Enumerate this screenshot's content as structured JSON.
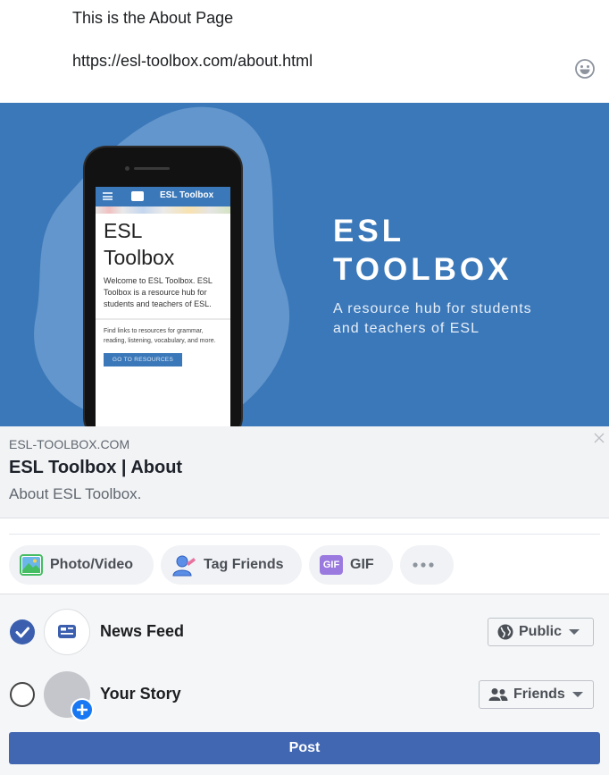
{
  "composer": {
    "text_line_1": "This is the About Page",
    "text_line_2": "https://esl-toolbox.com/about.html",
    "emoji_icon": "smiley-face-icon"
  },
  "banner": {
    "title_line_1": "ESL",
    "title_line_2": "TOOLBOX",
    "subtitle_line_1": "A resource hub for students",
    "subtitle_line_2": "and teachers of ESL",
    "background_color": "#3b78b9",
    "phone_screen": {
      "nav_brand": "ESL Toolbox",
      "title_line_1": "ESL",
      "title_line_2": "Toolbox",
      "paragraph": "Welcome to ESL Toolbox. ESL Toolbox is a resource hub for students and teachers of ESL.",
      "paragraph_2": "Find links to resources for grammar, reading, listening, vocabulary, and more.",
      "button": "GO TO RESOURCES"
    }
  },
  "link_preview": {
    "domain": "ESL-TOOLBOX.COM",
    "title": "ESL Toolbox | About",
    "description": "About ESL Toolbox."
  },
  "actions": {
    "photo_video": "Photo/Video",
    "tag_friends": "Tag Friends",
    "gif_badge": "GIF",
    "gif": "GIF",
    "more_icon": "ellipsis-icon"
  },
  "audience": {
    "news_feed": {
      "label": "News Feed",
      "checked": true,
      "privacy": "Public"
    },
    "your_story": {
      "label": "Your Story",
      "checked": false,
      "privacy": "Friends"
    }
  },
  "post_button": "Post",
  "colors": {
    "accent": "#4267b2",
    "check": "#3b5fae",
    "banner": "#3b78b9"
  }
}
